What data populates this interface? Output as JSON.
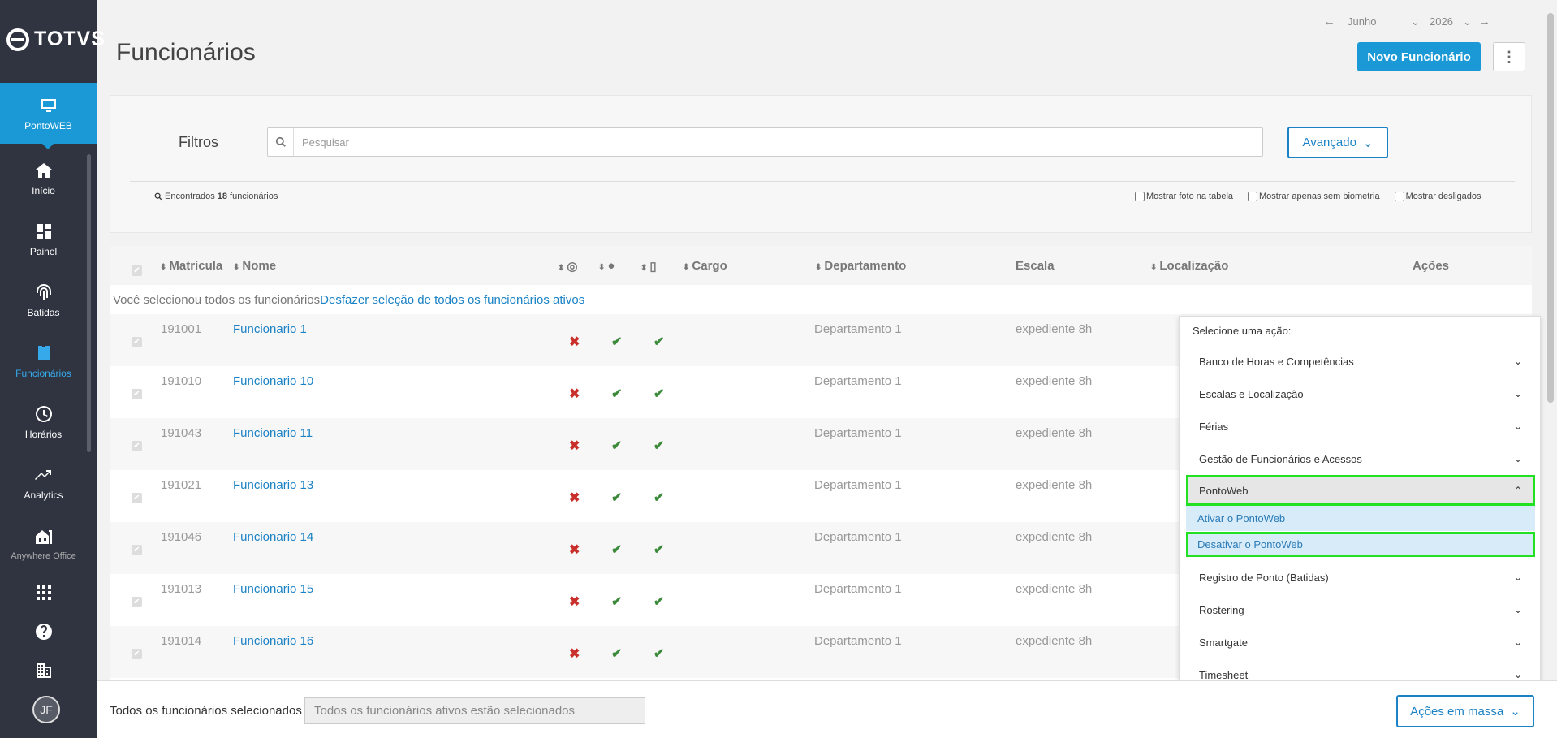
{
  "app": {
    "brand": "TOTVS"
  },
  "sidebar": {
    "items": [
      {
        "label": "PontoWEB",
        "icon": "monitor-icon"
      },
      {
        "label": "Início",
        "icon": "home-icon"
      },
      {
        "label": "Painel",
        "icon": "dashboard-icon"
      },
      {
        "label": "Batidas",
        "icon": "fingerprint-icon"
      },
      {
        "label": "Funcionários",
        "icon": "badge-icon"
      },
      {
        "label": "Horários",
        "icon": "clock-icon"
      },
      {
        "label": "Analytics",
        "icon": "trend-icon"
      },
      {
        "label": "Anywhere Office",
        "icon": "building-home-icon"
      }
    ],
    "bottom_icons": [
      "apps-grid-icon",
      "help-icon",
      "building-icon"
    ],
    "avatar": "JF"
  },
  "header": {
    "title": "Funcionários",
    "month": "Junho",
    "year": "2026",
    "new_button": "Novo Funcionário",
    "kebab": "⋮"
  },
  "filters": {
    "label": "Filtros",
    "search_placeholder": "Pesquisar",
    "search_value": "",
    "advanced_button": "Avançado",
    "found_prefix": "Encontrados",
    "found_count": "18",
    "found_suffix": "funcionários",
    "checkbox_photo": "Mostrar foto na tabela",
    "checkbox_biometry": "Mostrar apenas sem biometria",
    "checkbox_disconnected": "Mostrar desligados"
  },
  "table": {
    "columns": {
      "matricula": "Matrícula",
      "nome": "Nome",
      "cargo": "Cargo",
      "departamento": "Departamento",
      "escala": "Escala",
      "localizacao": "Localização",
      "acoes": "Ações"
    },
    "selection_note": "Você selecionou todos os funcionários",
    "selection_undo": "Desfazer seleção de todos os funcionários ativos",
    "rows": [
      {
        "id": "191001",
        "name": "Funcionario 1",
        "dept": "Departamento 1",
        "scale": "expediente 8h",
        "bio": "✖",
        "web": "✔",
        "mobile": "✔"
      },
      {
        "id": "191010",
        "name": "Funcionario 10",
        "dept": "Departamento 1",
        "scale": "expediente 8h",
        "bio": "✖",
        "web": "✔",
        "mobile": "✔"
      },
      {
        "id": "191043",
        "name": "Funcionario 11",
        "dept": "Departamento 1",
        "scale": "expediente 8h",
        "bio": "✖",
        "web": "✔",
        "mobile": "✔"
      },
      {
        "id": "191021",
        "name": "Funcionario 13",
        "dept": "Departamento 1",
        "scale": "expediente 8h",
        "bio": "✖",
        "web": "✔",
        "mobile": "✔"
      },
      {
        "id": "191046",
        "name": "Funcionario 14",
        "dept": "Departamento 1",
        "scale": "expediente 8h",
        "bio": "✖",
        "web": "✔",
        "mobile": "✔"
      },
      {
        "id": "191013",
        "name": "Funcionario 15",
        "dept": "Departamento 1",
        "scale": "expediente 8h",
        "bio": "✖",
        "web": "✔",
        "mobile": "✔"
      },
      {
        "id": "191014",
        "name": "Funcionario 16",
        "dept": "Departamento 1",
        "scale": "expediente 8h",
        "bio": "✖",
        "web": "✔",
        "mobile": "✔"
      }
    ]
  },
  "actions_dropdown": {
    "header": "Selecione uma ação:",
    "items": [
      "Banco de Horas e Competências",
      "Escalas e Localização",
      "Férias",
      "Gestão de Funcionários e Acessos",
      "PontoWeb",
      "Registro de Ponto (Batidas)",
      "Rostering",
      "Smartgate",
      "Timesheet"
    ],
    "subitems": [
      "Ativar o PontoWeb",
      "Desativar o PontoWeb"
    ]
  },
  "footer": {
    "label": "Todos os funcionários selecionados",
    "input_value": "Todos os funcionários ativos estão selecionados",
    "mass_button": "Ações em massa"
  },
  "colors": {
    "accent": "#1a99d6",
    "sidebar": "#2f3440",
    "highlight": "#22e022"
  }
}
